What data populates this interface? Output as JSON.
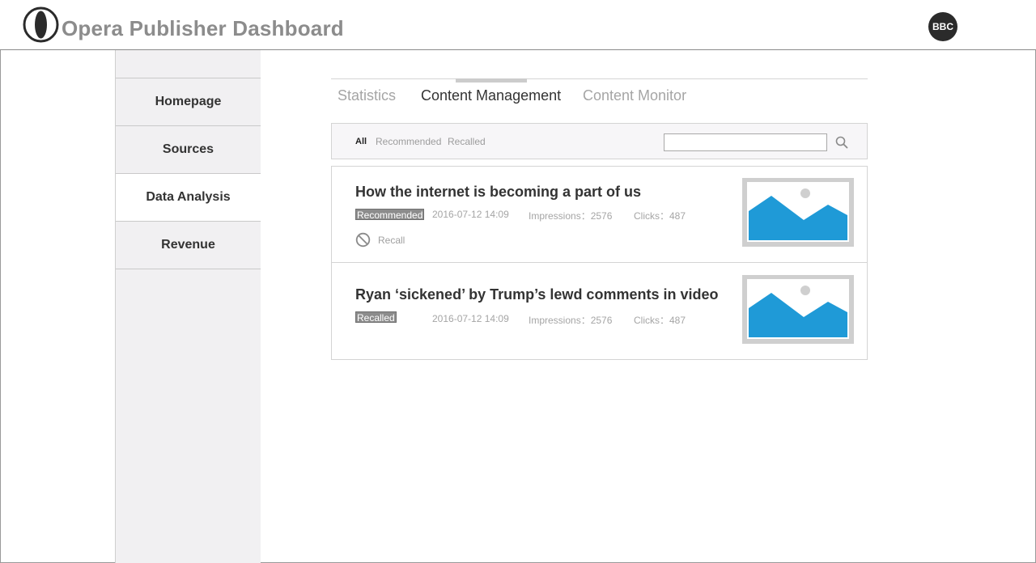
{
  "header": {
    "app_title": "Opera Publisher Dashboard",
    "avatar_label": "BBC"
  },
  "sidebar": {
    "items": [
      {
        "label": "Homepage",
        "active": false
      },
      {
        "label": "Sources",
        "active": false
      },
      {
        "label": "Data Analysis",
        "active": true
      },
      {
        "label": "Revenue",
        "active": false
      }
    ]
  },
  "tabs": [
    {
      "label": "Statistics",
      "active": false
    },
    {
      "label": "Content Management",
      "active": true
    },
    {
      "label": "Content Monitor",
      "active": false
    }
  ],
  "filters": [
    {
      "label": "All",
      "active": true
    },
    {
      "label": "Recommended",
      "active": false
    },
    {
      "label": "Recalled",
      "active": false
    }
  ],
  "search": {
    "value": "",
    "placeholder": ""
  },
  "articles": [
    {
      "title": "How the internet is becoming a part of us",
      "status": "Recommended",
      "datetime": "2016-07-12 14:09",
      "impressions_label": "Impressions：2576",
      "clicks_label": "Clicks：487",
      "action_label": "Recall",
      "thumbnail_icon": "image-placeholder-icon"
    },
    {
      "title": "Ryan ‘sickened’ by Trump’s lewd comments in video",
      "status": "Recalled",
      "datetime": "2016-07-12 14:09",
      "impressions_label": "Impressions：2576",
      "clicks_label": "Clicks：487",
      "thumbnail_icon": "image-placeholder-icon"
    }
  ],
  "colors": {
    "accent_image_blue": "#1f9ad7",
    "badge_gray": "#8c8c8c",
    "sidebar_bg": "#f1f0f2"
  }
}
